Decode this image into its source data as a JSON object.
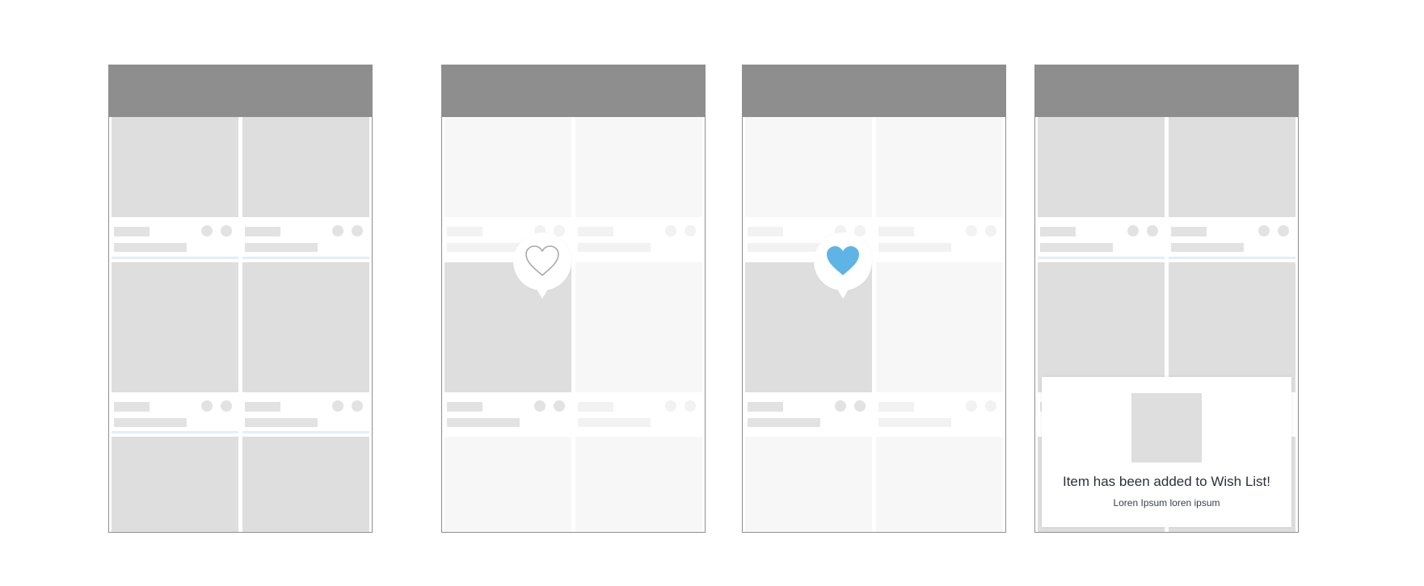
{
  "colors": {
    "topbar": "#8e8e8e",
    "frame_border": "#8e8e8e",
    "placeholder": "#dedede",
    "placeholder_faded": "#f7f7f7",
    "heart_filled": "#5fb4e6",
    "heart_outline": "#a9a9a9",
    "separator_accent": "#e6eef4"
  },
  "icons": {
    "heart_outline": "heart-outline-icon",
    "heart_filled": "heart-filled-icon"
  },
  "toast": {
    "title": "Item has been added to Wish List!",
    "subtitle": "Loren Ipsum loren ipsum"
  }
}
